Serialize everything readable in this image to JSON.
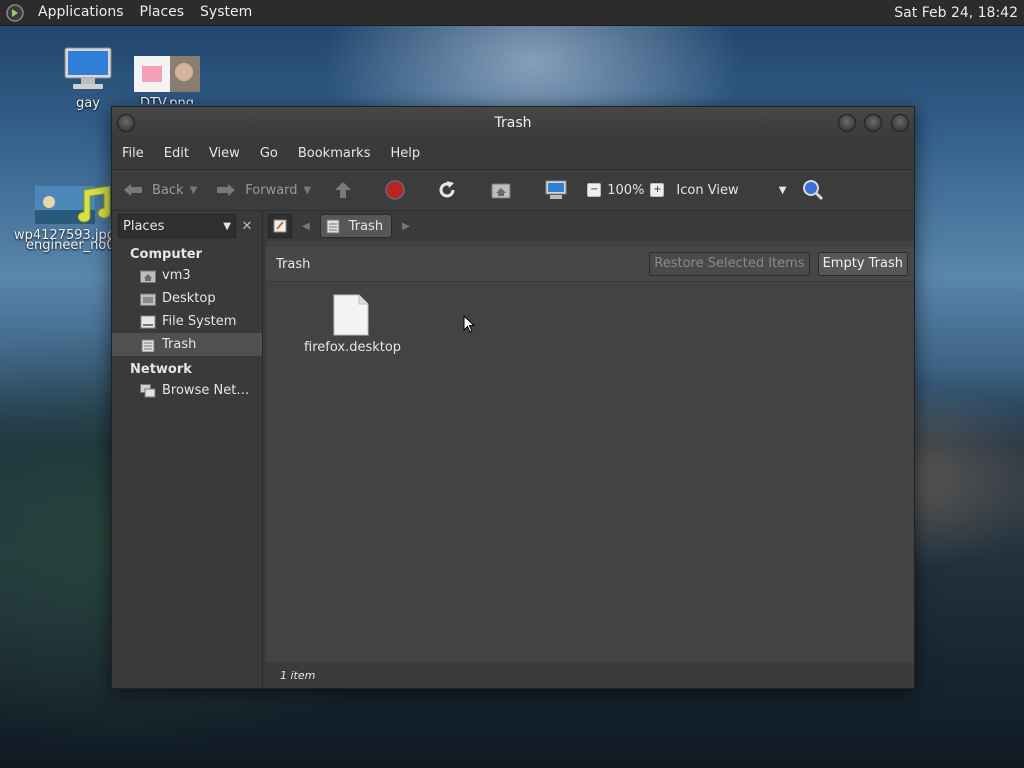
{
  "top_panel": {
    "menus": [
      "Applications",
      "Places",
      "System"
    ],
    "clock": "Sat Feb 24, 18:42"
  },
  "desktop_icons": [
    {
      "label": "gay",
      "icon": "computer-icon"
    },
    {
      "label": "DTV.png",
      "icon": "image-icon"
    },
    {
      "label": "wp4127593.jpg",
      "icon": "image-icon"
    },
    {
      "label": "engineer_no0",
      "icon": "music-icon"
    }
  ],
  "window": {
    "title": "Trash",
    "menubar": [
      "File",
      "Edit",
      "View",
      "Go",
      "Bookmarks",
      "Help"
    ],
    "toolbar": {
      "back": "Back",
      "forward": "Forward",
      "zoom": "100%",
      "view_mode": "Icon View"
    },
    "sidebar": {
      "selector": "Places",
      "sections": [
        {
          "title": "Computer",
          "items": [
            {
              "label": "vm3",
              "icon": "home-folder-icon"
            },
            {
              "label": "Desktop",
              "icon": "desktop-folder-icon"
            },
            {
              "label": "File System",
              "icon": "drive-icon"
            },
            {
              "label": "Trash",
              "icon": "trash-icon",
              "selected": true
            }
          ]
        },
        {
          "title": "Network",
          "items": [
            {
              "label": "Browse Net…",
              "icon": "network-icon"
            }
          ]
        }
      ]
    },
    "pathbar": {
      "current": "Trash"
    },
    "infobar": {
      "title": "Trash",
      "restore_label": "Restore Selected Items",
      "empty_label": "Empty Trash"
    },
    "files": [
      {
        "name": "firefox.desktop",
        "icon": "file-icon"
      }
    ],
    "status": "1 item"
  },
  "colors": {
    "window_bg": "#3a3a3a",
    "content_bg": "#434343",
    "panel_bg": "#2c2c2c"
  }
}
